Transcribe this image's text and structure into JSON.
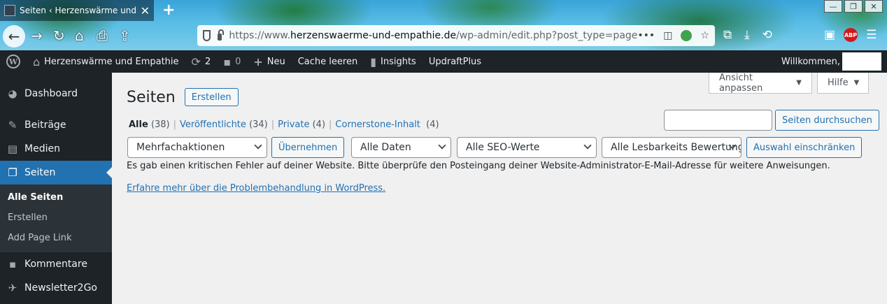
{
  "browser": {
    "tab_title": "Seiten ‹ Herzenswärme und Em",
    "url_prefix": "https://www.",
    "url_domain": "herzenswaerme-und-empathie.de",
    "url_path": "/wp-admin/edit.php?post_type=page",
    "url_more": "•••",
    "window_controls": [
      "—",
      "❐",
      "✕"
    ]
  },
  "adminbar": {
    "site_name": "Herzenswärme und Empathie",
    "updates_count": "2",
    "comments_count": "0",
    "new_label": "Neu",
    "cache_label": "Cache leeren",
    "insights_label": "Insights",
    "updraft_label": "UpdraftPlus",
    "welcome_label": "Willkommen,"
  },
  "sidebar": {
    "items": [
      {
        "label": "Dashboard",
        "icon": "dashboard-icon"
      },
      {
        "label": "Beiträge",
        "icon": "pin-icon"
      },
      {
        "label": "Medien",
        "icon": "media-icon"
      },
      {
        "label": "Seiten",
        "icon": "pages-icon"
      }
    ],
    "submenu": [
      "Alle Seiten",
      "Erstellen",
      "Add Page Link"
    ],
    "items_after": [
      {
        "label": "Kommentare",
        "icon": "comment-icon"
      },
      {
        "label": "Newsletter2Go",
        "icon": "newsletter-icon"
      }
    ]
  },
  "main": {
    "screen_options": "Ansicht anpassen",
    "help": "Hilfe",
    "title": "Seiten",
    "add_new": "Erstellen",
    "views": {
      "all_label": "Alle",
      "all_count": "(38)",
      "published_label": "Veröffentlichte",
      "published_count": "(34)",
      "private_label": "Private",
      "private_count": "(4)",
      "cornerstone_label": "Cornerstone-Inhalt",
      "cornerstone_count": "(4)"
    },
    "search_button": "Seiten durchsuchen",
    "search_value": "",
    "bulk_actions": "Mehrfachaktionen",
    "apply": "Übernehmen",
    "date_filter": "Alle Daten",
    "seo_filter": "Alle SEO-Werte",
    "readability_filter": "Alle Lesbarkeits Bewertungen",
    "filter_button": "Auswahl einschränken",
    "error_message": "Es gab einen kritischen Fehler auf deiner Website. Bitte überprüfe den Posteingang deiner Website-Administrator-E-Mail-Adresse für weitere Anweisungen.",
    "help_link": "Erfahre mehr über die Problembehandlung in WordPress."
  },
  "colors": {
    "wp_accent": "#2271b1",
    "adminbar_bg": "#1d2327",
    "content_bg": "#f0f0f1"
  }
}
